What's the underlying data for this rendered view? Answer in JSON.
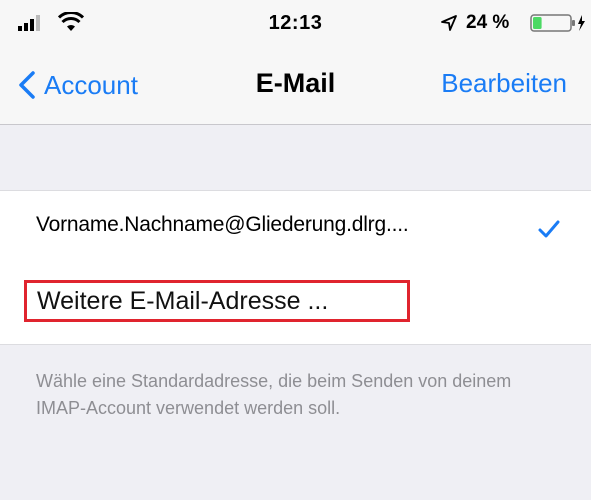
{
  "status_bar": {
    "time": "12:13",
    "battery_percent": "24 %",
    "battery_level": 0.24,
    "icons": [
      "signal-icon",
      "wifi-icon",
      "location-icon",
      "battery-icon"
    ]
  },
  "nav": {
    "back_label": "Account",
    "title": "E-Mail",
    "edit_label": "Bearbeiten"
  },
  "email_list": {
    "current_address": "Vorname.Nachname@Gliederung.dlrg....",
    "add_address_label": "Weitere E-Mail-Adresse ..."
  },
  "footer_text": "Wähle eine Standardadresse, die beim Senden von deinem IMAP-Account verwendet werden soll.",
  "colors": {
    "accent": "#1a7cf5",
    "highlight_border": "#e0242e",
    "battery_fill": "#4cd964",
    "background": "#efeff4"
  }
}
